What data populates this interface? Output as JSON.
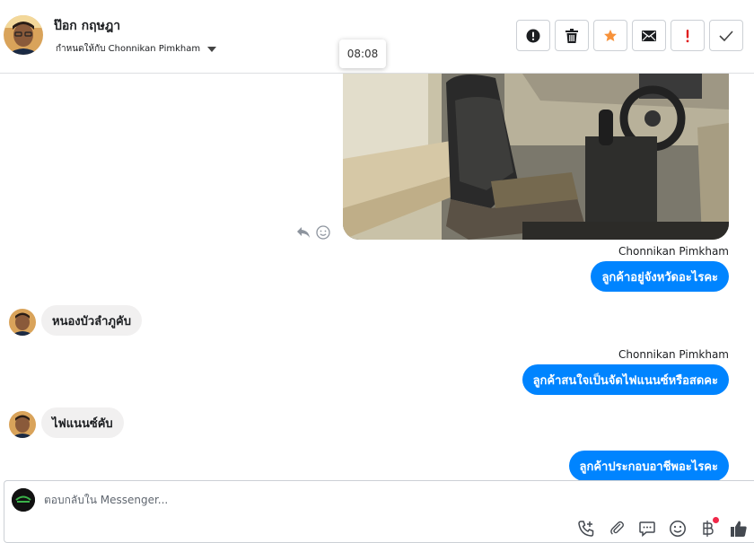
{
  "header": {
    "contact_name": "ป๊อก กฤษฎา",
    "assigned_label": "กำหนดให้กับ Chonnikan Pimkham",
    "actions": [
      {
        "name": "spam-button",
        "icon": "exclamation-circle-icon"
      },
      {
        "name": "delete-button",
        "icon": "trash-icon"
      },
      {
        "name": "star-button",
        "icon": "star-icon"
      },
      {
        "name": "mark-unread-button",
        "icon": "envelope-icon"
      },
      {
        "name": "follow-up-button",
        "icon": "exclamation-icon"
      },
      {
        "name": "mark-done-button",
        "icon": "check-icon"
      }
    ]
  },
  "tooltip": {
    "time": "08:08"
  },
  "messages": [
    {
      "sender": "Chonnikan Pimkham",
      "text": "ลูกค้าอยู่จังหวัดอะไรคะ",
      "direction": "out"
    },
    {
      "text": "หนองบัวลำภูคับ",
      "direction": "in"
    },
    {
      "sender": "Chonnikan Pimkham",
      "text": "ลูกค้าสนใจเป็นจัดไฟแนนซ์หรือสดคะ",
      "direction": "out"
    },
    {
      "text": "ไฟแนนซ์คับ",
      "direction": "in"
    },
    {
      "text": "ลูกค้าประกอบอาชีพอะไรคะ",
      "direction": "out"
    }
  ],
  "composer": {
    "placeholder": "ตอบกลับใน Messenger...",
    "tools": [
      "phone-plus-icon",
      "paperclip-icon",
      "chat-bubble-icon",
      "smiley-icon",
      "baht-icon",
      "thumbs-up-icon"
    ]
  },
  "colors": {
    "accent": "#0084ff",
    "incoming_bubble": "#f1f0f0",
    "star": "#f7923a",
    "alert": "#e02020",
    "notification_dot": "#f02849"
  }
}
